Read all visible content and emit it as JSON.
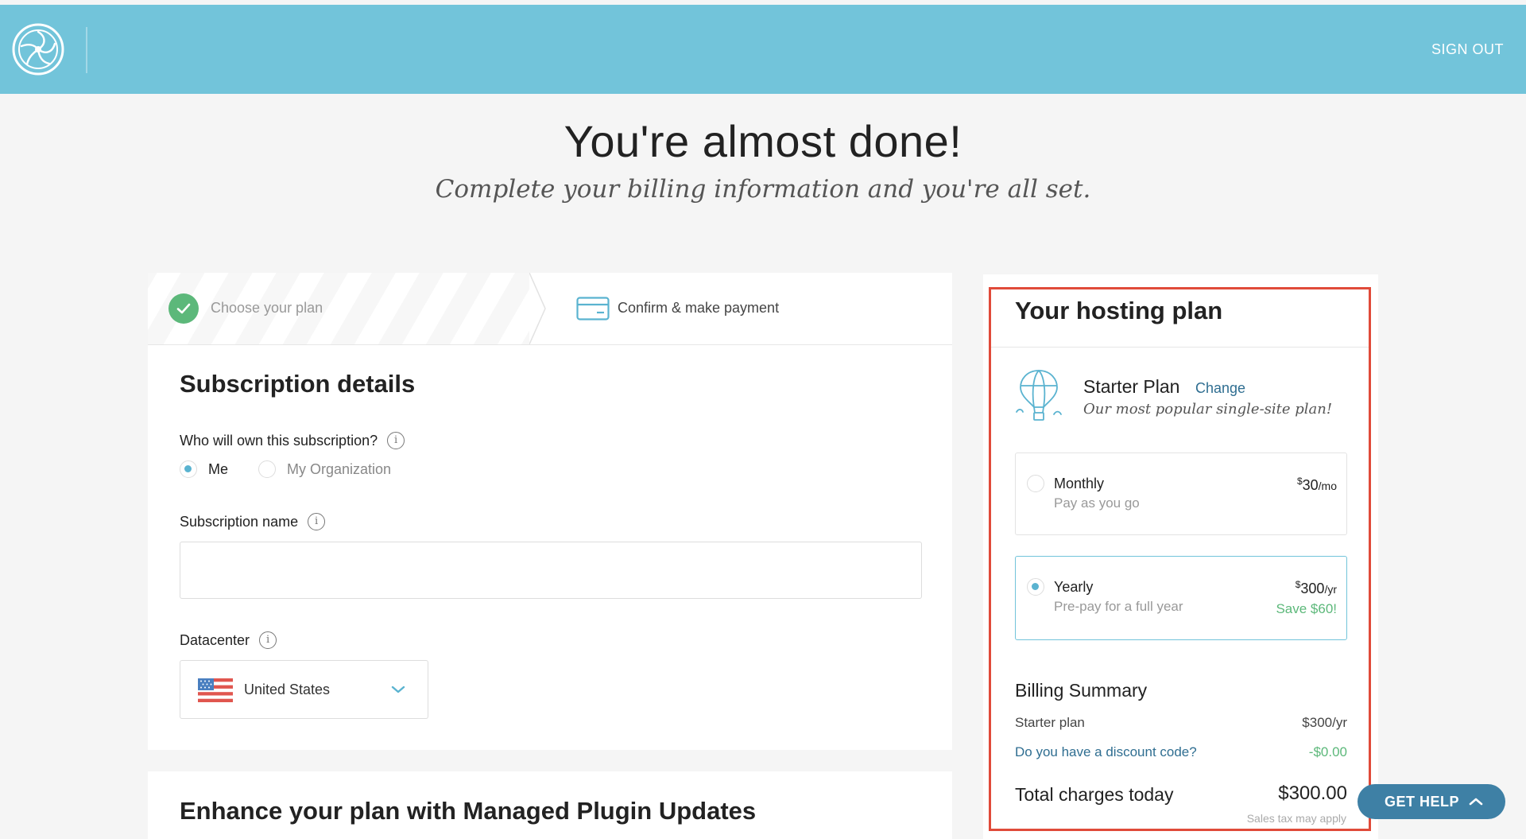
{
  "header": {
    "sign_out": "SIGN OUT"
  },
  "hero": {
    "title": "You're almost done!",
    "subtitle": "Complete your billing information and you're all set."
  },
  "steps": [
    {
      "label": "Choose your plan",
      "state": "complete"
    },
    {
      "label": "Confirm & make payment",
      "state": "active"
    }
  ],
  "subscription": {
    "title": "Subscription details",
    "owner_question": "Who will own this subscription?",
    "owner_options": [
      {
        "label": "Me",
        "selected": true
      },
      {
        "label": "My Organization",
        "selected": false
      }
    ],
    "name_label": "Subscription name",
    "name_value": "",
    "datacenter_label": "Datacenter",
    "datacenter_value": "United States"
  },
  "enhance": {
    "title": "Enhance your plan with Managed Plugin Updates"
  },
  "plan": {
    "header": "Your hosting plan",
    "name": "Starter Plan",
    "change": "Change",
    "tagline": "Our most popular single-site plan!",
    "options": [
      {
        "title": "Monthly",
        "subtitle": "Pay as you go",
        "currency": "$",
        "amount": "30",
        "unit": "/mo",
        "save": "",
        "selected": false
      },
      {
        "title": "Yearly",
        "subtitle": "Pre-pay for a full year",
        "currency": "$",
        "amount": "300",
        "unit": "/yr",
        "save": "Save $60!",
        "selected": true
      }
    ]
  },
  "billing": {
    "title": "Billing Summary",
    "rows": [
      {
        "label": "Starter plan",
        "value": "$300/yr"
      },
      {
        "label": "Do you have a discount code?",
        "value": "-$0.00"
      }
    ],
    "total_label": "Total charges today",
    "total_value": "$300.00",
    "tax_note": "Sales tax may apply"
  },
  "help": {
    "label": "GET HELP"
  },
  "colors": {
    "header_bg": "#72c4da",
    "accent_green": "#5cb87a",
    "link_blue": "#2f6e91",
    "highlight_red": "#e04b3a",
    "help_button": "#3e80a5"
  }
}
